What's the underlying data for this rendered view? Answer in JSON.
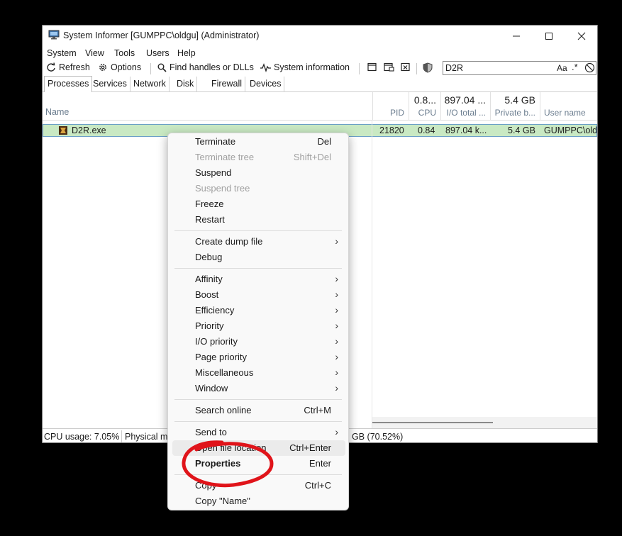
{
  "window": {
    "title": "System Informer [GUMPPC\\oldgu] (Administrator)"
  },
  "menubar": [
    "System",
    "View",
    "Tools",
    "Users",
    "Help"
  ],
  "toolbar": {
    "refresh": "Refresh",
    "options": "Options",
    "find_handles": "Find handles or DLLs",
    "system_information": "System information"
  },
  "search": {
    "value": "D2R",
    "case_label": "Aa",
    "regex_label": ".*"
  },
  "tabs": [
    "Processes",
    "Services",
    "Network",
    "Disk",
    "Firewall",
    "Devices"
  ],
  "columns": {
    "name": "Name",
    "pid": "PID",
    "cpu": {
      "label": "CPU",
      "total": "0.8..."
    },
    "io": {
      "label": "I/O total ...",
      "total": "897.04 ..."
    },
    "private": {
      "label": "Private b...",
      "total": "5.4 GB"
    },
    "user": "User name"
  },
  "process": {
    "name": "D2R.exe",
    "pid": "21820",
    "cpu": "0.84",
    "io": "897.04 k...",
    "private": "5.4 GB",
    "user": "GUMPPC\\old"
  },
  "status": {
    "cpu_usage": "CPU usage: 7.05%",
    "physical_memory": "Physical me",
    "memory_tail": "GB (70.52%)"
  },
  "context_menu": {
    "terminate": {
      "label": "Terminate",
      "shortcut": "Del"
    },
    "terminate_tree": {
      "label": "Terminate tree",
      "shortcut": "Shift+Del"
    },
    "suspend": "Suspend",
    "suspend_tree": "Suspend tree",
    "freeze": "Freeze",
    "restart": "Restart",
    "create_dump": "Create dump file",
    "debug": "Debug",
    "affinity": "Affinity",
    "boost": "Boost",
    "efficiency": "Efficiency",
    "priority": "Priority",
    "io_priority": "I/O priority",
    "page_priority": "Page priority",
    "miscellaneous": "Miscellaneous",
    "window": "Window",
    "search_online": {
      "label": "Search online",
      "shortcut": "Ctrl+M"
    },
    "send_to": "Send to",
    "open_file_location": {
      "label": "Open file location",
      "shortcut": "Ctrl+Enter"
    },
    "properties": {
      "label": "Properties",
      "shortcut": "Enter"
    },
    "copy": {
      "label": "Copy",
      "shortcut": "Ctrl+C"
    },
    "copy_name": "Copy \"Name\""
  },
  "colors": {
    "selected_row": "#c9e9c3",
    "annotation_circle": "#e0141a"
  }
}
